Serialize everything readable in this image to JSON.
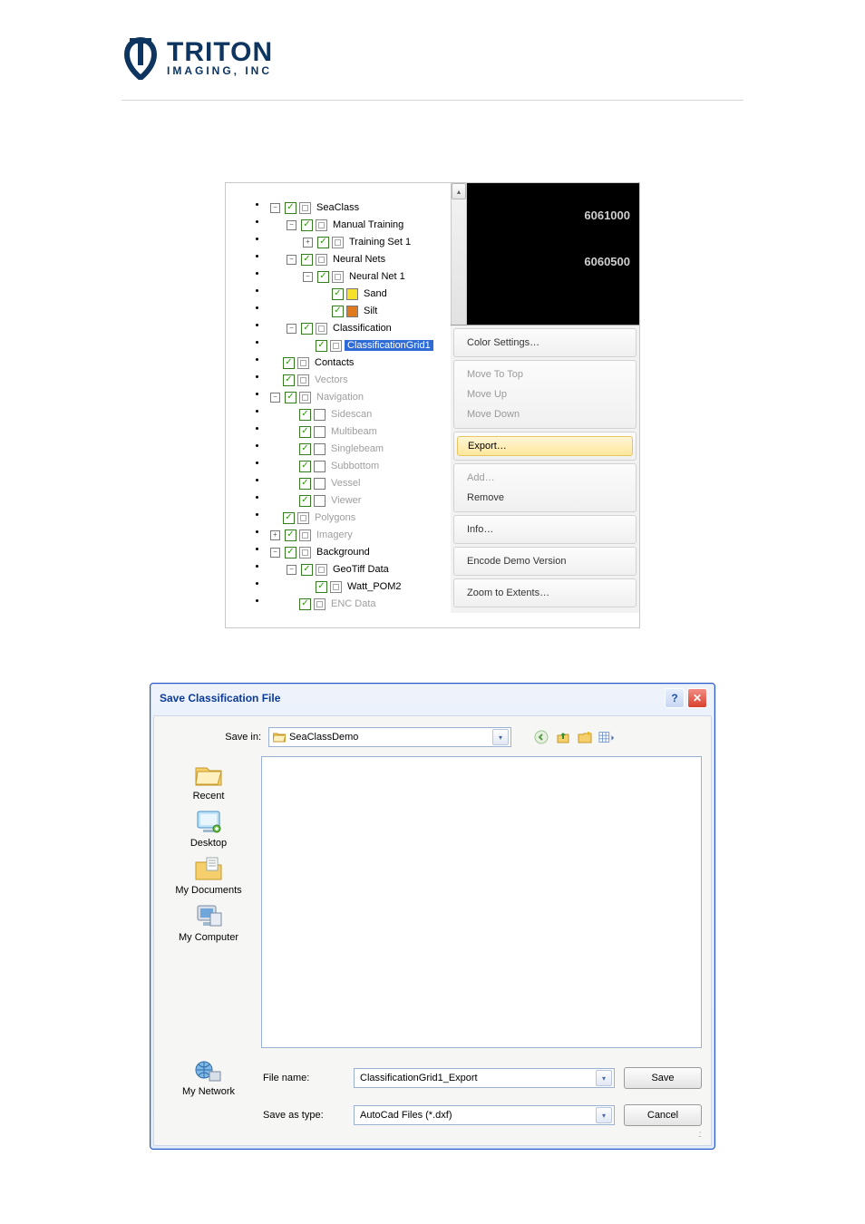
{
  "logo": {
    "line1": "TRITON",
    "line2": "IMAGING, INC"
  },
  "tree": [
    {
      "pm": "-",
      "depth": 0,
      "cb": true,
      "icon": "stack",
      "label": "SeaClass"
    },
    {
      "pm": "-",
      "depth": 1,
      "cb": true,
      "icon": "stack",
      "label": "Manual Training"
    },
    {
      "pm": "+",
      "depth": 2,
      "cb": true,
      "icon": "stack",
      "label": "Training Set 1"
    },
    {
      "pm": "-",
      "depth": 1,
      "cb": true,
      "icon": "stack",
      "label": "Neural Nets"
    },
    {
      "pm": "-",
      "depth": 2,
      "cb": true,
      "icon": "stack",
      "label": "Neural Net 1"
    },
    {
      "pm": "",
      "depth": 3,
      "cb": true,
      "icon": "color",
      "color": "#f5e02a",
      "label": "Sand"
    },
    {
      "pm": "",
      "depth": 3,
      "cb": true,
      "icon": "color",
      "color": "#e07a1c",
      "label": "Silt"
    },
    {
      "pm": "-",
      "depth": 1,
      "cb": true,
      "icon": "stack",
      "label": "Classification"
    },
    {
      "pm": "",
      "depth": 2,
      "cb": true,
      "icon": "stack",
      "label": "ClassificationGrid1",
      "selected": true
    },
    {
      "pm": "",
      "depth": 0,
      "cb": true,
      "icon": "stack",
      "label": "Contacts"
    },
    {
      "pm": "",
      "depth": 0,
      "cb": true,
      "icon": "stack",
      "label": "Vectors",
      "dim": true
    },
    {
      "pm": "-",
      "depth": 0,
      "cb": true,
      "icon": "stack",
      "label": "Navigation",
      "dim": true
    },
    {
      "pm": "",
      "depth": 1,
      "cb": true,
      "icon": "box",
      "label": "Sidescan",
      "dim": true
    },
    {
      "pm": "",
      "depth": 1,
      "cb": true,
      "icon": "box",
      "label": "Multibeam",
      "dim": true
    },
    {
      "pm": "",
      "depth": 1,
      "cb": true,
      "icon": "box",
      "label": "Singlebeam",
      "dim": true
    },
    {
      "pm": "",
      "depth": 1,
      "cb": true,
      "icon": "box",
      "label": "Subbottom",
      "dim": true
    },
    {
      "pm": "",
      "depth": 1,
      "cb": true,
      "icon": "box",
      "label": "Vessel",
      "dim": true
    },
    {
      "pm": "",
      "depth": 1,
      "cb": true,
      "icon": "box",
      "label": "Viewer",
      "dim": true
    },
    {
      "pm": "",
      "depth": 0,
      "cb": true,
      "icon": "stack",
      "label": "Polygons",
      "dim": true
    },
    {
      "pm": "+",
      "depth": 0,
      "cb": true,
      "icon": "stack",
      "label": "Imagery",
      "dim": true
    },
    {
      "pm": "-",
      "depth": 0,
      "cb": true,
      "icon": "stack",
      "label": "Background"
    },
    {
      "pm": "-",
      "depth": 1,
      "cb": true,
      "icon": "stack",
      "label": "GeoTiff Data"
    },
    {
      "pm": "",
      "depth": 2,
      "cb": true,
      "icon": "stack",
      "label": "Watt_POM2"
    },
    {
      "pm": "",
      "depth": 1,
      "cb": true,
      "icon": "stack",
      "label": "ENC Data",
      "dim": true
    }
  ],
  "map_ticks": [
    "6061000",
    "6060500"
  ],
  "context_menu": {
    "groups": [
      [
        {
          "label": "Color Settings…"
        }
      ],
      [
        {
          "label": "Move To Top",
          "dim": true
        },
        {
          "label": "Move Up",
          "dim": true
        },
        {
          "label": "Move Down",
          "dim": true
        }
      ],
      [
        {
          "label": "Export…",
          "hover": true
        }
      ],
      [
        {
          "label": "Add…",
          "dim": true
        },
        {
          "label": "Remove"
        }
      ],
      [
        {
          "label": "Info…"
        }
      ],
      [
        {
          "label": "Encode Demo Version"
        }
      ],
      [
        {
          "label": "Zoom to Extents…"
        }
      ]
    ]
  },
  "dialog": {
    "title": "Save Classification File",
    "savein_label": "Save in:",
    "savein_value": "SeaClassDemo",
    "places": [
      "Recent",
      "Desktop",
      "My Documents",
      "My Computer",
      "My Network"
    ],
    "filename_label": "File name:",
    "filename_value": "ClassificationGrid1_Export",
    "filetype_label": "Save as type:",
    "filetype_value": "AutoCad Files (*.dxf)",
    "save_btn": "Save",
    "cancel_btn": "Cancel"
  }
}
